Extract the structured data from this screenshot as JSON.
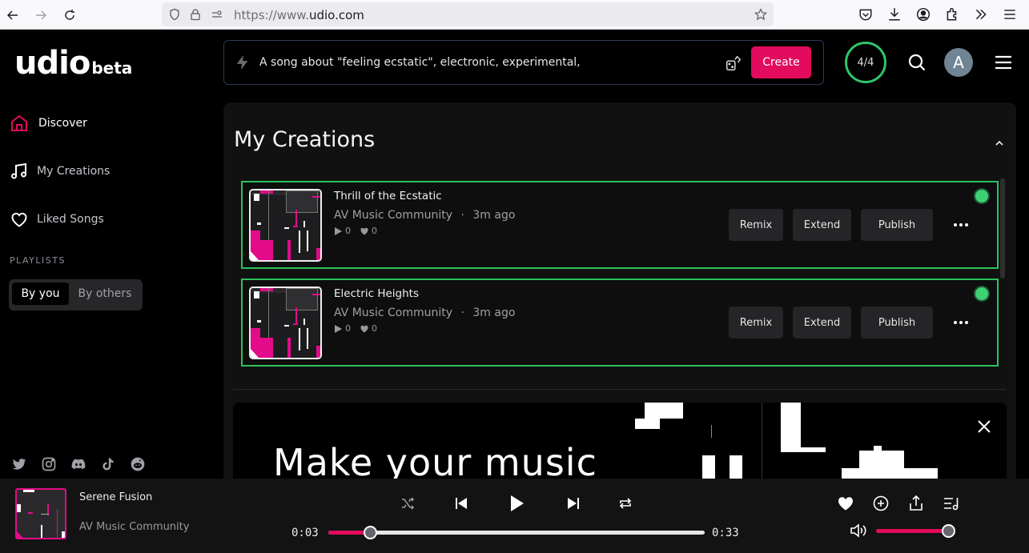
{
  "browser": {
    "url_prefix": "https://www.",
    "url_domain": "udio.com"
  },
  "app": {
    "logo": "udio",
    "logo_badge": "beta"
  },
  "sidebar": {
    "items": [
      {
        "label": "Discover",
        "icon": "home-icon",
        "active": true
      },
      {
        "label": "My Creations",
        "icon": "music-note-icon",
        "active": false
      },
      {
        "label": "Liked Songs",
        "icon": "heart-icon",
        "active": false
      }
    ],
    "playlists_label": "PLAYLISTS",
    "playlist_tabs": [
      {
        "label": "By you",
        "active": true
      },
      {
        "label": "By others",
        "active": false
      }
    ],
    "socials": [
      "twitter-icon",
      "instagram-icon",
      "discord-icon",
      "tiktok-icon",
      "reddit-icon"
    ]
  },
  "header": {
    "prompt_value": "A song about \"feeling ecstatic\", electronic, experimental,",
    "create_label": "Create",
    "credits": "4/4",
    "avatar_initial": "A"
  },
  "main": {
    "title": "My Creations",
    "songs": [
      {
        "title": "Thrill of the Ecstatic",
        "artist": "AV Music Community",
        "time": "3m ago",
        "plays": "0",
        "likes": "0"
      },
      {
        "title": "Electric Heights",
        "artist": "AV Music Community",
        "time": "3m ago",
        "plays": "0",
        "likes": "0"
      }
    ],
    "actions": {
      "remix": "Remix",
      "extend": "Extend",
      "publish": "Publish"
    },
    "separator": "·",
    "banner_text": "Make your music"
  },
  "player": {
    "title": "Serene Fusion",
    "artist": "AV Music Community",
    "current_time": "0:03",
    "duration": "0:33",
    "progress_percent": 11,
    "volume_percent": 100
  },
  "colors": {
    "accent": "#e30b5d",
    "success": "#2bc35a"
  }
}
